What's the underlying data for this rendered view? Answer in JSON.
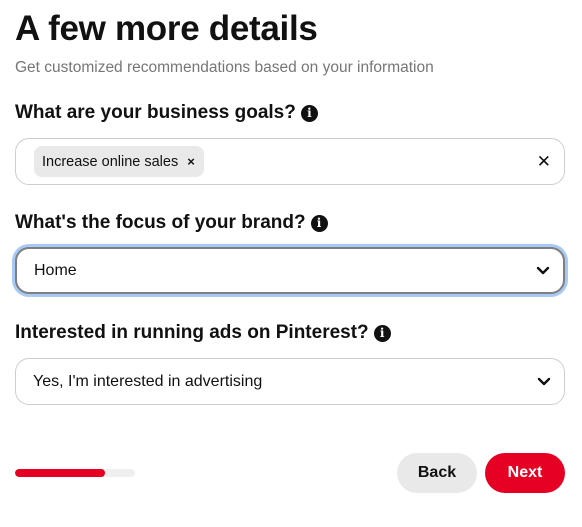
{
  "header": {
    "title": "A few more details",
    "subtitle": "Get customized recommendations based on your information"
  },
  "business_goals": {
    "label": "What are your business goals?",
    "info_icon": "info-icon",
    "chips": [
      {
        "label": "Increase online sales",
        "remove_glyph": "×"
      }
    ],
    "clear_glyph": "✕"
  },
  "brand_focus": {
    "label": "What's the focus of your brand?",
    "info_icon": "info-icon",
    "selected_value": "Home",
    "chevron_icon": "chevron-down-icon",
    "focused": true
  },
  "ads_interest": {
    "label": "Interested in running ads on Pinterest?",
    "info_icon": "info-icon",
    "selected_value": "Yes, I'm interested in advertising",
    "chevron_icon": "chevron-down-icon"
  },
  "progress": {
    "fraction": 0.75
  },
  "footer": {
    "back_label": "Back",
    "next_label": "Next"
  },
  "colors": {
    "accent": "#e60023",
    "focus_ring": "#a9c9f5",
    "muted_text": "#767676",
    "chip_bg": "#e9e9e9"
  }
}
